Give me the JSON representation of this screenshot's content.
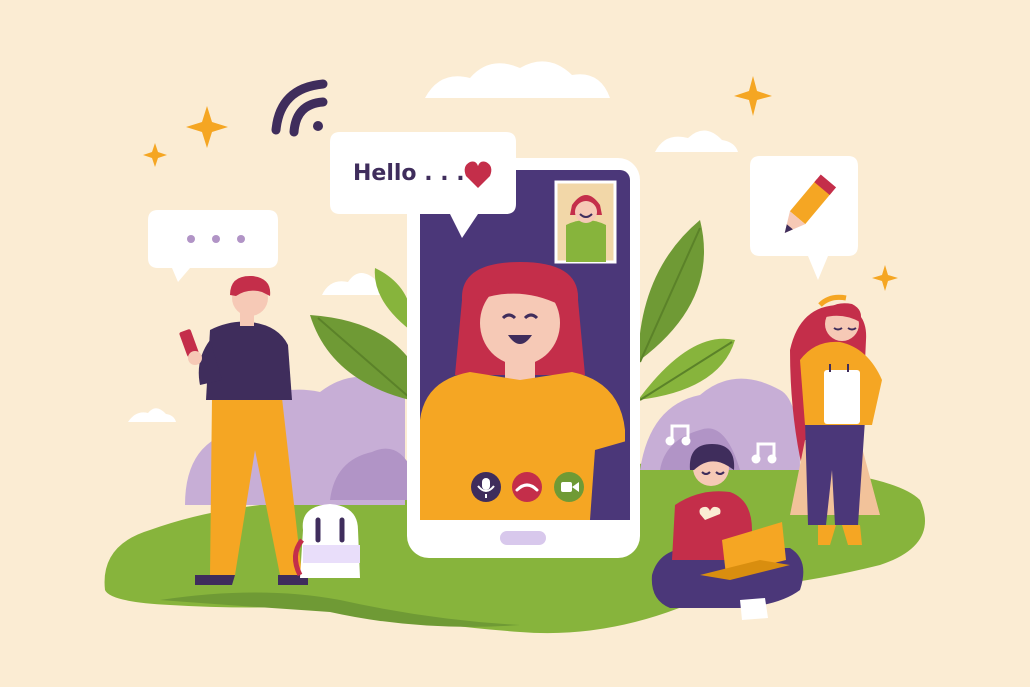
{
  "greeting": {
    "text": "Hello . . ."
  },
  "colors": {
    "background": "#fbecd3",
    "phone_screen": "#4b3779",
    "hair": "#c42e4a",
    "shirt": "#f5a623",
    "grass": "#87b43c",
    "leaves": "#6f9a35",
    "bushes": "#c7aed6",
    "accent_star": "#f5a623",
    "heart": "#c42e4a"
  },
  "icons": {
    "wifi": "wifi-icon",
    "heart": "heart-icon",
    "typing": "typing-dots-icon",
    "pencil": "pencil-icon",
    "music": "music-note-icon",
    "mic": "mic-icon",
    "end_call": "end-call-icon",
    "video": "video-camera-icon",
    "sparkle": "sparkle-icon"
  },
  "call_controls": [
    "mute",
    "end-call",
    "video"
  ]
}
